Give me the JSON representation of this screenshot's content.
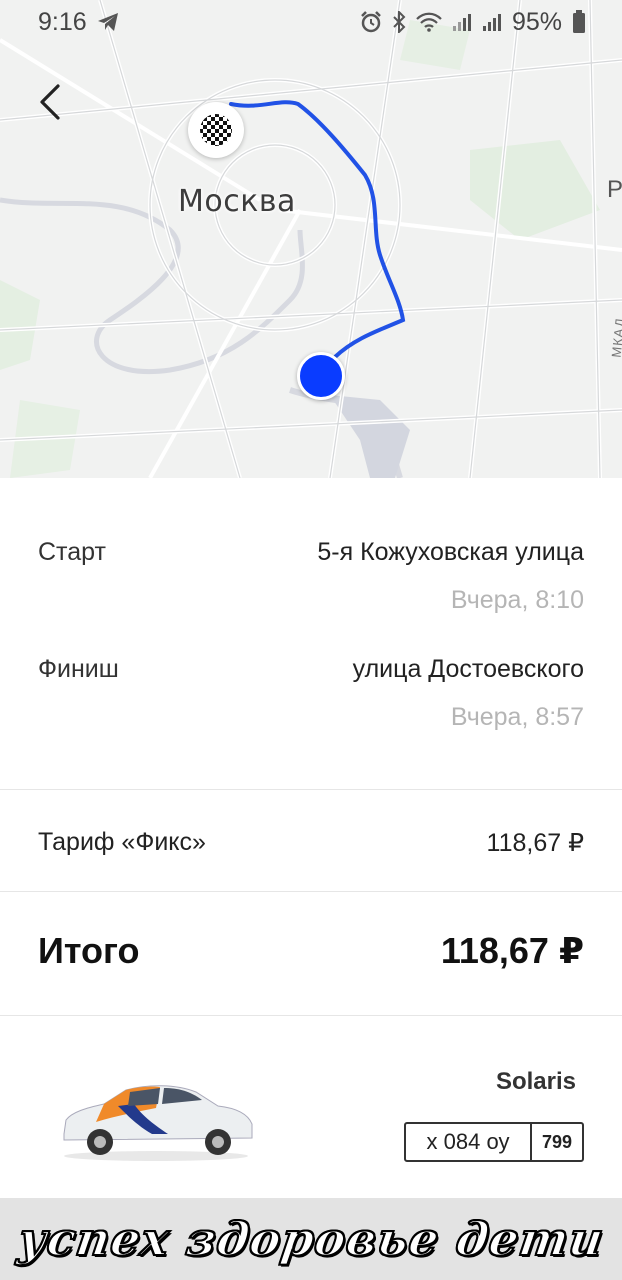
{
  "status_bar": {
    "time": "9:16",
    "battery": "95%",
    "icons": [
      "telegram-icon",
      "alarm-icon",
      "bluetooth-icon",
      "wifi-icon",
      "signal-icon",
      "signal-icon",
      "battery-icon"
    ]
  },
  "map": {
    "city_label": "Москва",
    "edge_letter": "Р",
    "ring_road_label": "МКАД",
    "route_color": "#1f4fe0",
    "start_marker_color": "#0a3cff"
  },
  "trip": {
    "start": {
      "label": "Старт",
      "address": "5-я Кожуховская улица",
      "time": "Вчера, 8:10"
    },
    "finish": {
      "label": "Финиш",
      "address": "улица Достоевского",
      "time": "Вчера, 8:57"
    }
  },
  "tariff": {
    "label": "Тариф «Фикс»",
    "price": "118,67 ₽"
  },
  "total": {
    "label": "Итого",
    "price": "118,67 ₽"
  },
  "car": {
    "model": "Solaris",
    "plate_number": "х 084 оу",
    "plate_region": "799"
  },
  "overlay": {
    "text": "успех здоровье дети"
  }
}
